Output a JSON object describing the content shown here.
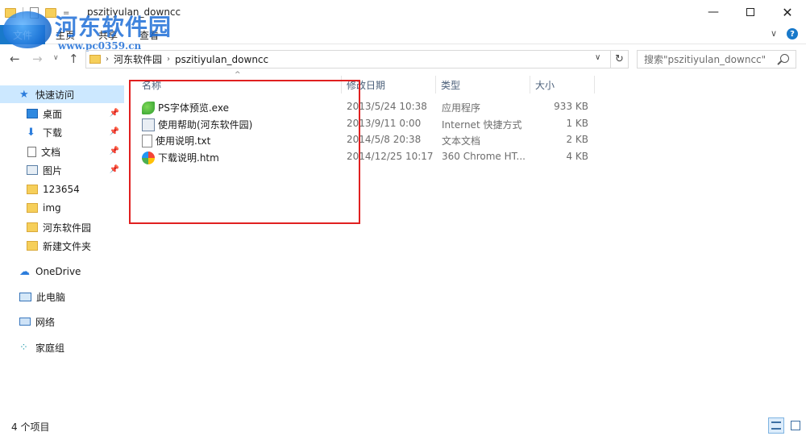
{
  "window": {
    "title": "pszitiyulan_downcc",
    "minimize_glyph": "—",
    "close_glyph": "✕",
    "qat_dropdown": "="
  },
  "ribbon": {
    "file_tab": "文件",
    "tabs": [
      "主页",
      "共享",
      "查看"
    ],
    "expand_glyph": "∨",
    "help_glyph": "?"
  },
  "watermark": {
    "site_name": "河东软件园",
    "url": "www.pc0359.cn"
  },
  "address_bar": {
    "back_glyph": "←",
    "forward_glyph": "→",
    "recent_glyph": "∨",
    "up_glyph": "↑",
    "separator": "›",
    "path": [
      "河东软件园",
      "pszitiyulan_downcc"
    ],
    "dropdown_glyph": "∨",
    "refresh_glyph": "↻",
    "search_placeholder": "搜索\"pszitiyulan_downcc\""
  },
  "nav_pane": {
    "items": [
      {
        "label": "快速访问",
        "icon": "star-icon",
        "selected": true
      },
      {
        "label": "桌面",
        "icon": "desktop-icon",
        "pinned": true
      },
      {
        "label": "下载",
        "icon": "download-icon",
        "pinned": true
      },
      {
        "label": "文档",
        "icon": "document-icon",
        "pinned": true
      },
      {
        "label": "图片",
        "icon": "pictures-icon",
        "pinned": true
      },
      {
        "label": "123654",
        "icon": "folder-icon"
      },
      {
        "label": "img",
        "icon": "folder-icon"
      },
      {
        "label": "河东软件园",
        "icon": "folder-icon"
      },
      {
        "label": "新建文件夹",
        "icon": "folder-icon"
      },
      {
        "label": "OneDrive",
        "icon": "cloud-icon"
      },
      {
        "label": "此电脑",
        "icon": "computer-icon"
      },
      {
        "label": "网络",
        "icon": "network-icon"
      },
      {
        "label": "家庭组",
        "icon": "homegroup-icon"
      }
    ],
    "pin_glyph": "📌"
  },
  "columns": {
    "name": "名称",
    "date": "修改日期",
    "type": "类型",
    "size": "大小",
    "sort_glyph": "^"
  },
  "files": [
    {
      "name": "PS字体预览.exe",
      "date": "2013/5/24 10:38",
      "type": "应用程序",
      "size": "933 KB",
      "icon": "exe-icon"
    },
    {
      "name": "使用帮助(河东软件园)",
      "date": "2013/9/11 0:00",
      "type": "Internet 快捷方式",
      "size": "1 KB",
      "icon": "url-shortcut-icon"
    },
    {
      "name": "使用说明.txt",
      "date": "2014/5/8 20:38",
      "type": "文本文档",
      "size": "2 KB",
      "icon": "text-file-icon"
    },
    {
      "name": "下载说明.htm",
      "date": "2014/12/25 10:17",
      "type": "360 Chrome HT...",
      "size": "4 KB",
      "icon": "html-file-icon"
    }
  ],
  "status_bar": {
    "item_count": "4 个项目"
  },
  "colors": {
    "accent": "#1979ca",
    "highlight_box": "#e02020",
    "selected_bg": "#cce8ff"
  }
}
